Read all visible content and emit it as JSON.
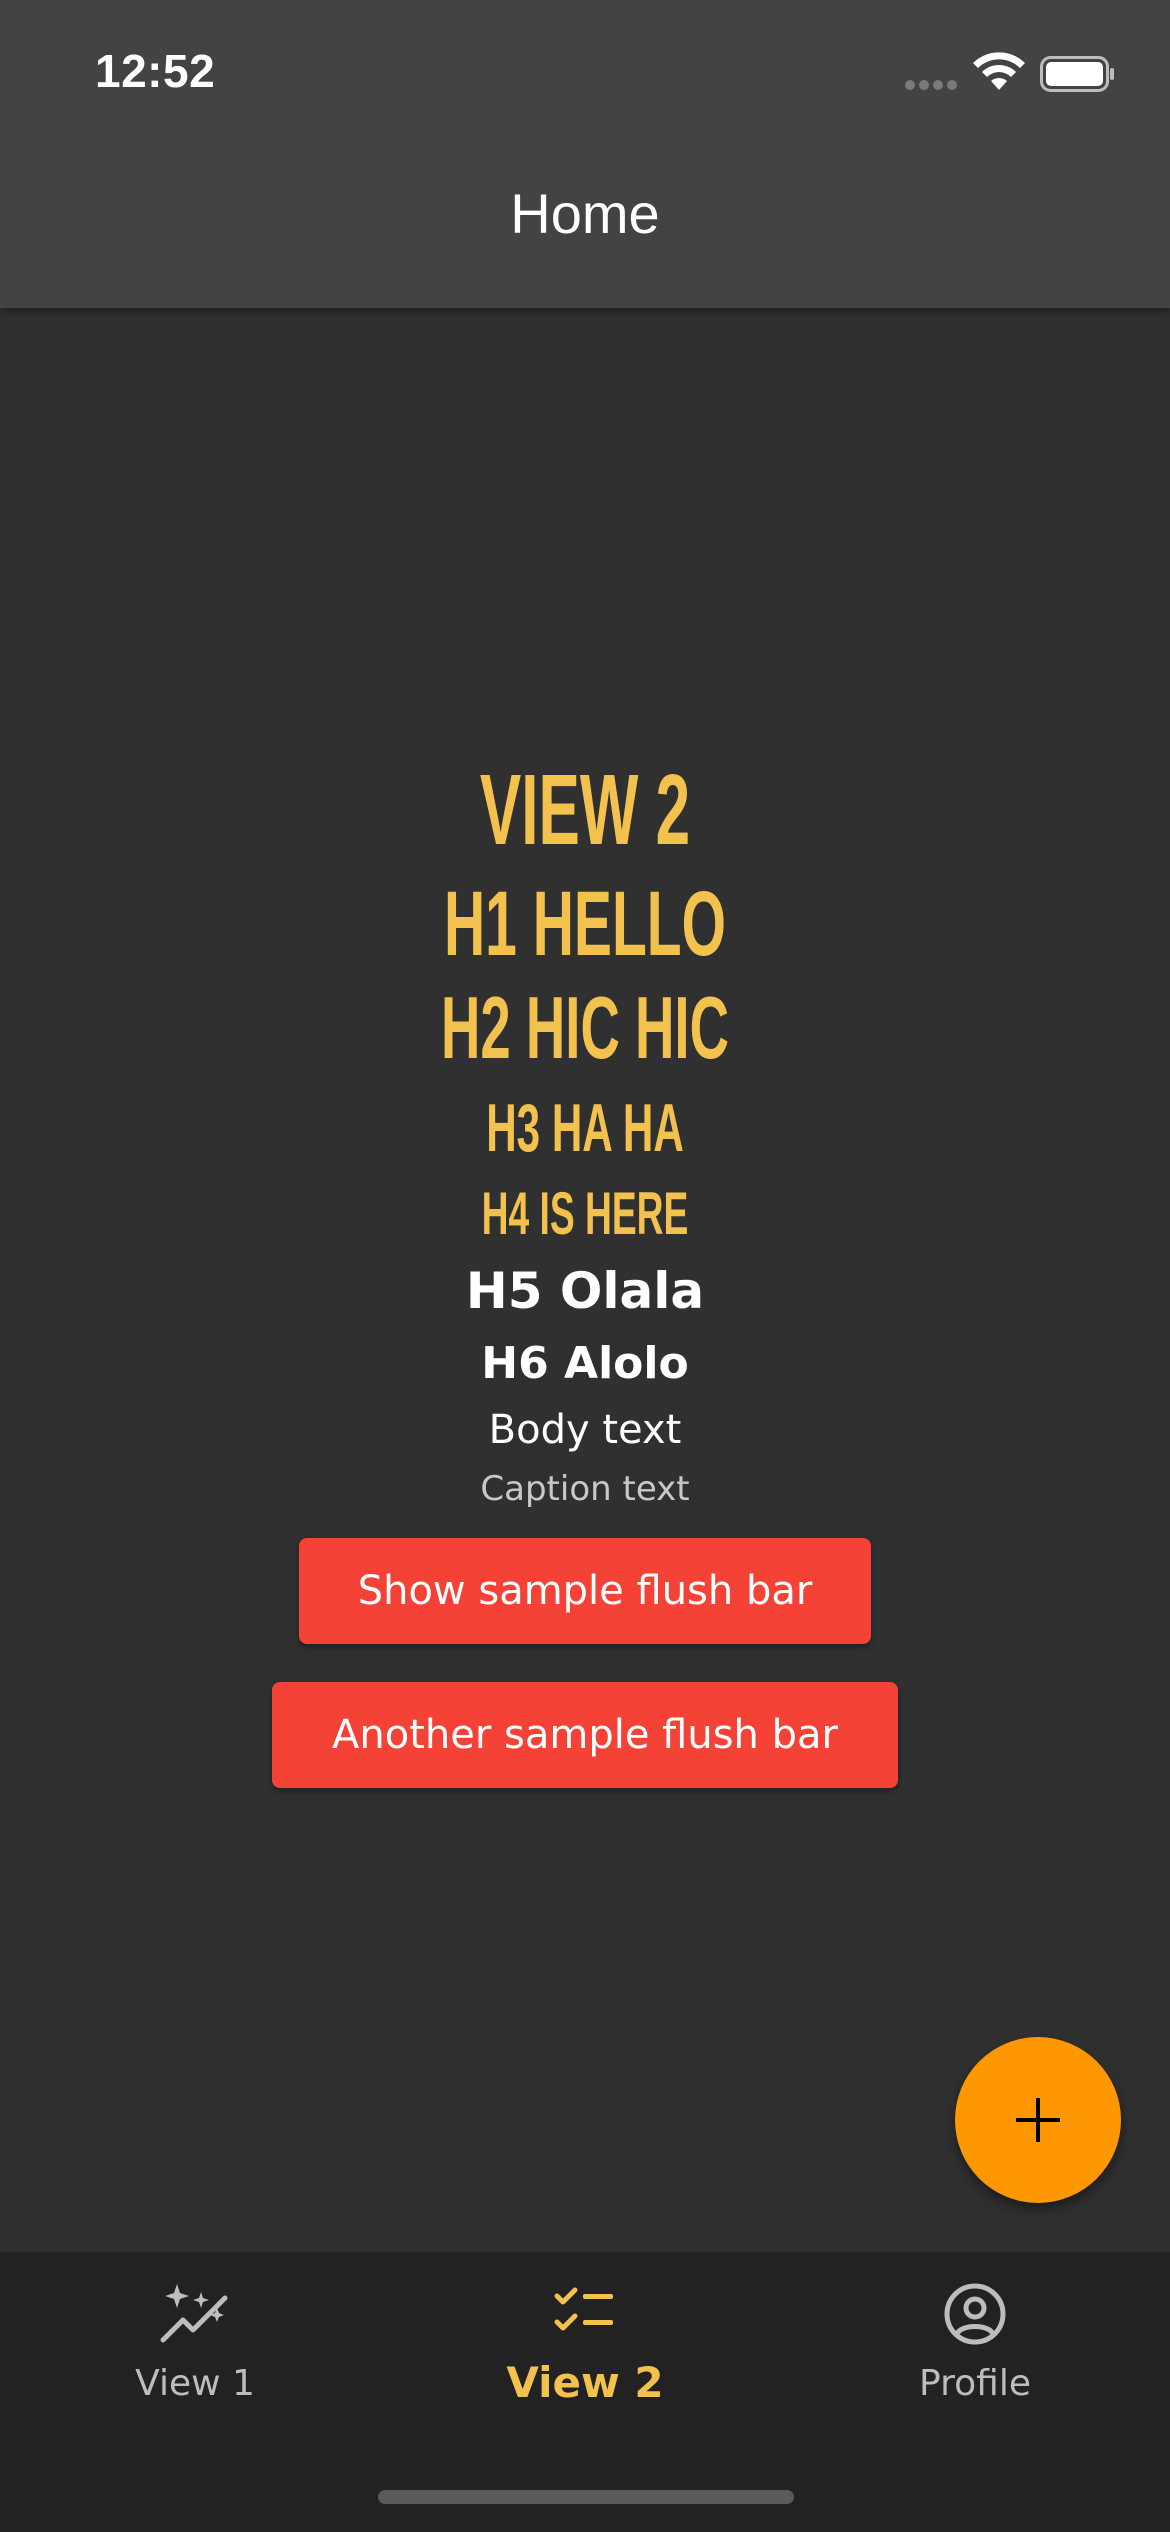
{
  "status_bar": {
    "time": "12:52"
  },
  "app_bar": {
    "title": "Home"
  },
  "content": {
    "view_title": "VIEW 2",
    "h1": "H1 HELLO",
    "h2": "H2 HIC HIC",
    "h3": "H3 HA HA",
    "h4": "H4 IS HERE",
    "h5": "H5 Olala",
    "h6": "H6 Alolo",
    "body": "Body text",
    "caption": "Caption text"
  },
  "buttons": {
    "flush1": "Show sample flush bar",
    "flush2": "Another sample flush bar"
  },
  "fab": {
    "icon": "plus-icon"
  },
  "bottom_nav": {
    "items": [
      {
        "label": "View 1",
        "icon": "sparkles-chart-icon",
        "active": false
      },
      {
        "label": "View 2",
        "icon": "checklist-icon",
        "active": true
      },
      {
        "label": "Profile",
        "icon": "account-circle-icon",
        "active": false
      }
    ]
  },
  "colors": {
    "background": "#303030",
    "app_bar": "#434343",
    "accent_yellow": "#f2c14e",
    "button_red": "#f44336",
    "fab_orange": "#ff9800",
    "nav_background": "#222222"
  }
}
